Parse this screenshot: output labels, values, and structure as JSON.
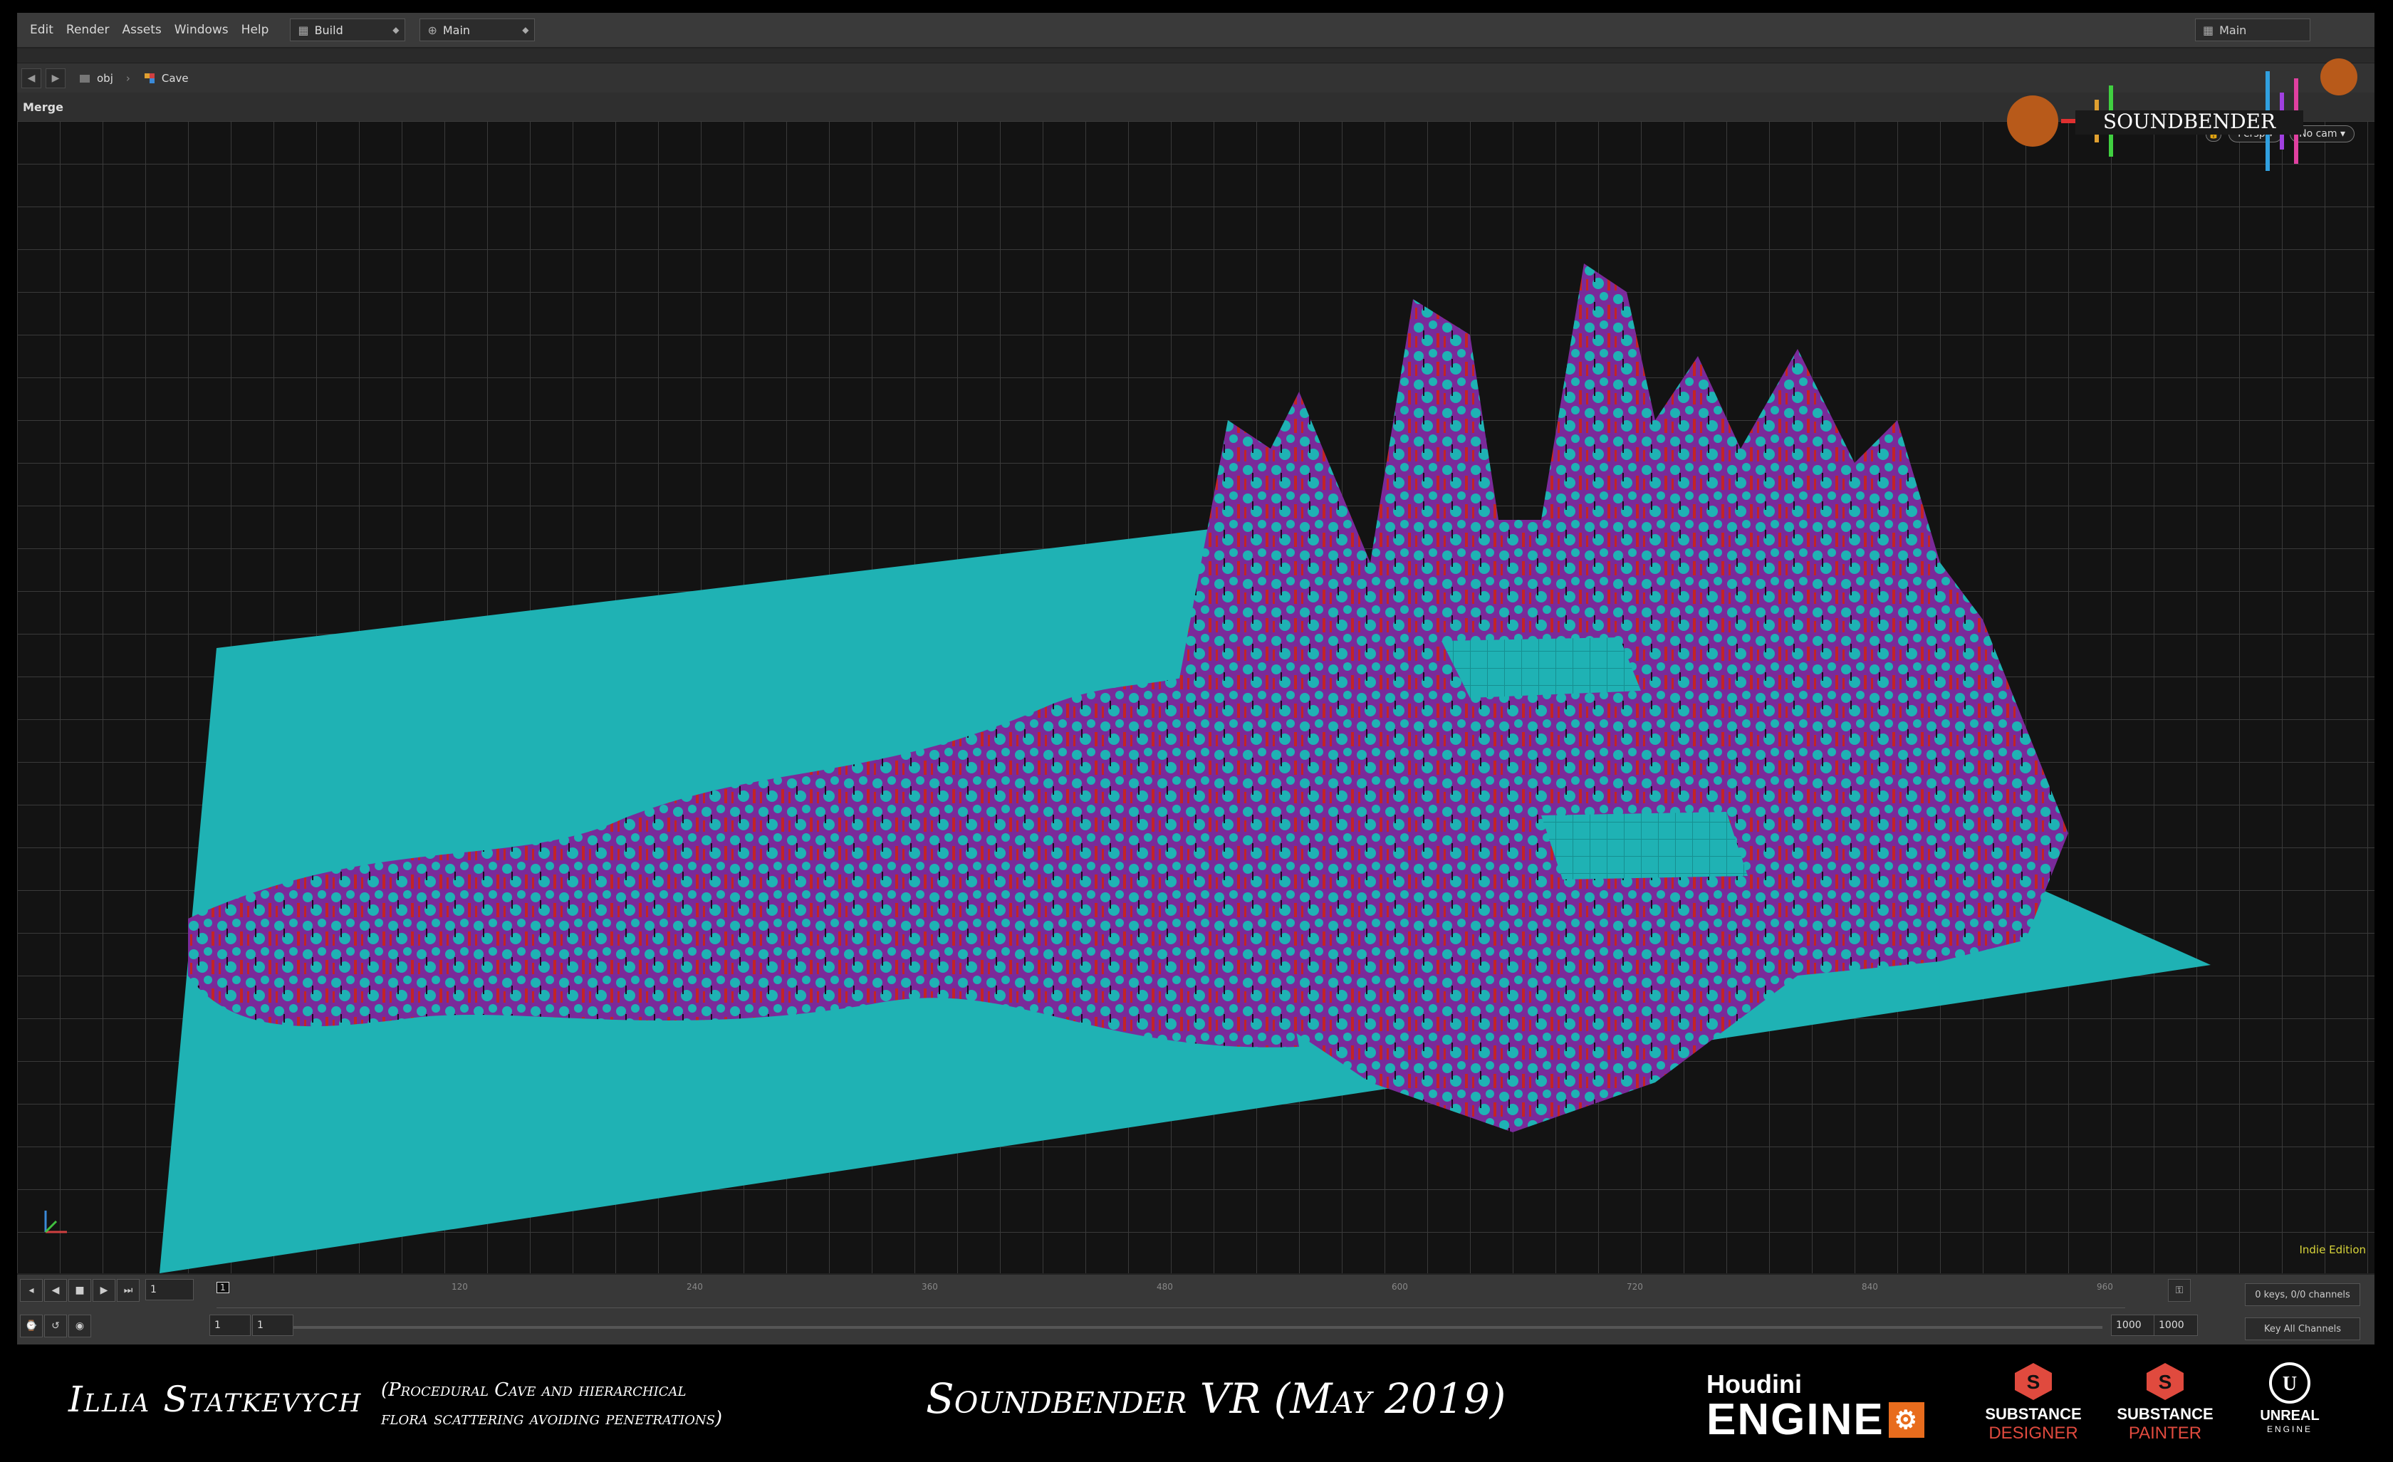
{
  "menubar": {
    "items": [
      "Edit",
      "Render",
      "Assets",
      "Windows",
      "Help"
    ],
    "desk_left": "Build",
    "desk_mid": "Main",
    "desk_right": "Main"
  },
  "pathbar": {
    "seg1": "obj",
    "seg2": "Cave"
  },
  "viewbar": {
    "title": "Merge"
  },
  "viewport": {
    "persp_label": "Persp",
    "cam_label": "No cam",
    "indie_label": "Indie Edition"
  },
  "timeline": {
    "current_frame": "1",
    "frame_marker": "1",
    "ticks": [
      "120",
      "240",
      "360",
      "480",
      "600",
      "720",
      "840",
      "960"
    ],
    "range_start": "1",
    "range_start2": "1",
    "range_end": "1000",
    "range_end2": "1000",
    "keys_info": "0 keys, 0/0 channels",
    "key_all": "Key All Channels"
  },
  "credits": {
    "author": "Illia Statkevych",
    "desc_line1": "(Procedural Cave and hierarchical",
    "desc_line2": "flora scattering avoiding penetrations)",
    "project": "Soundbender  VR (May 2019)",
    "houdini_1": "Houdini",
    "houdini_2": "ENGINE",
    "sd_1": "SUBSTANCE",
    "sd_2": "DESIGNER",
    "sp_1": "SUBSTANCE",
    "sp_2": "PAINTER",
    "ue_1": "UNREAL",
    "ue_2": "ENGINE",
    "game_logo": "SOUNDBENDER"
  },
  "colors": {
    "terrain_base": "#1fb2b4",
    "terrain_purple": "#7a2a9a",
    "terrain_red": "#c42424",
    "accent_orange": "#e86c1d",
    "substance_red": "#e04a3e"
  }
}
